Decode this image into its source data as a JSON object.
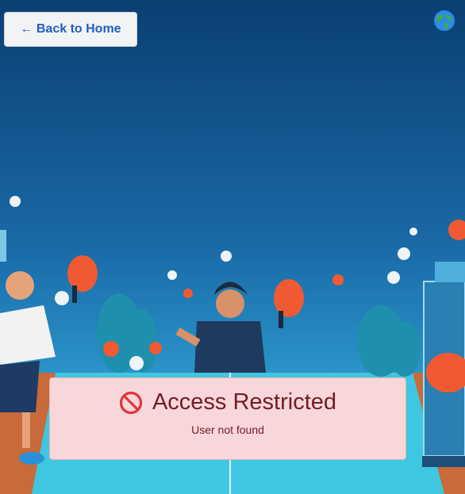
{
  "nav": {
    "back_label": "← Back to Home",
    "language_icon": "globe-icon"
  },
  "alert": {
    "title": "Access Restricted",
    "message": "User not found",
    "icon": "no-entry-icon"
  },
  "colors": {
    "alert_bg": "#f8d7da",
    "alert_text": "#721c24",
    "link_blue": "#1f5fbf"
  }
}
